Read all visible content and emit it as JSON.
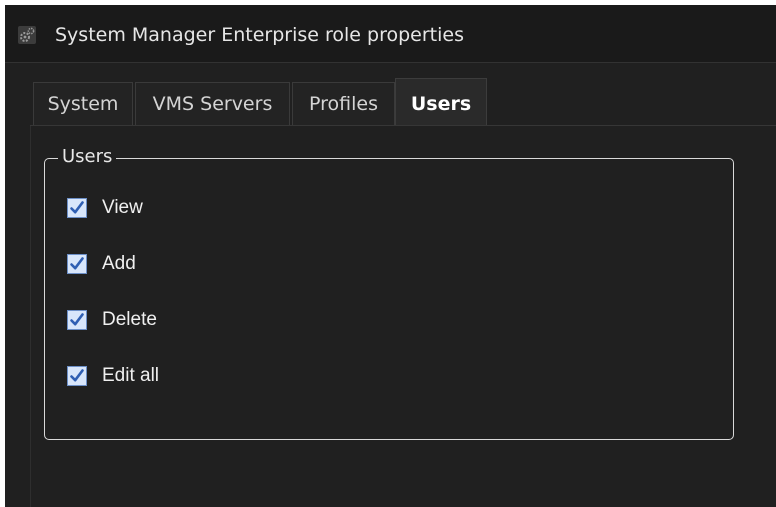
{
  "window": {
    "title": "System Manager Enterprise role properties",
    "icon": "gear-icon"
  },
  "tabs": [
    {
      "label": "System",
      "active": false
    },
    {
      "label": "VMS Servers",
      "active": false
    },
    {
      "label": "Profiles",
      "active": false
    },
    {
      "label": "Users",
      "active": true
    }
  ],
  "users_group": {
    "legend": "Users",
    "permissions": [
      {
        "label": "View",
        "checked": true
      },
      {
        "label": "Add",
        "checked": true
      },
      {
        "label": "Delete",
        "checked": true
      },
      {
        "label": "Edit all",
        "checked": true
      }
    ]
  },
  "colors": {
    "window_bg": "#202020",
    "checkbox_fill": "#d8e6fb",
    "checkmark": "#2f5fb3"
  }
}
